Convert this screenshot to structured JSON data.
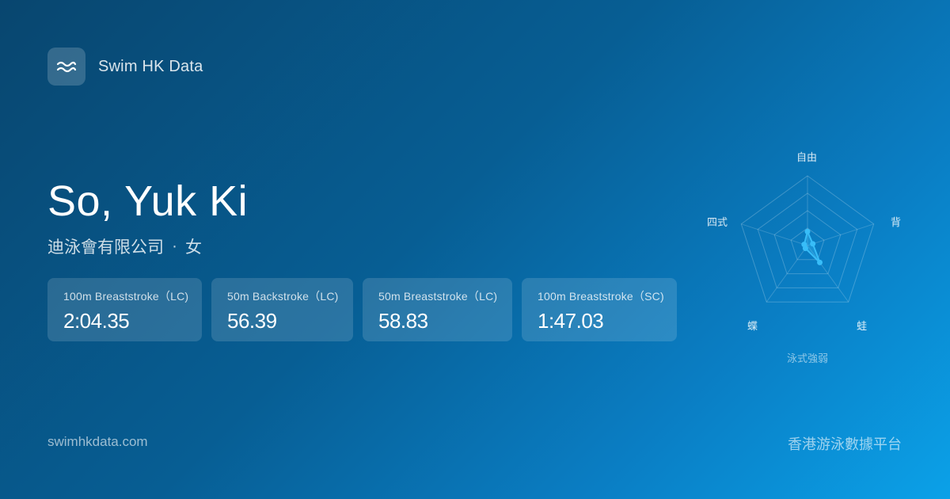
{
  "brand": {
    "name": "Swim HK Data",
    "logo_icon": "waves-icon"
  },
  "athlete": {
    "name": "So, Yuk Ki",
    "club": "迪泳會有限公司",
    "separator": "·",
    "gender": "女"
  },
  "best_times": [
    {
      "event": "100m Breaststroke（LC)",
      "time": "2:04.35"
    },
    {
      "event": "50m Backstroke（LC)",
      "time": "56.39"
    },
    {
      "event": "50m Breaststroke（LC)",
      "time": "58.83"
    },
    {
      "event": "100m Breaststroke（SC)",
      "time": "1:47.03"
    }
  ],
  "radar": {
    "caption": "泳式強弱",
    "axes": [
      "自由",
      "背",
      "蛙",
      "蝶",
      "四式"
    ],
    "values": [
      0.2,
      0.08,
      0.3,
      0.05,
      0.05
    ],
    "levels": 4,
    "accent_color": "#38bdf8"
  },
  "footer": {
    "url": "swimhkdata.com",
    "tagline": "香港游泳數據平台"
  }
}
